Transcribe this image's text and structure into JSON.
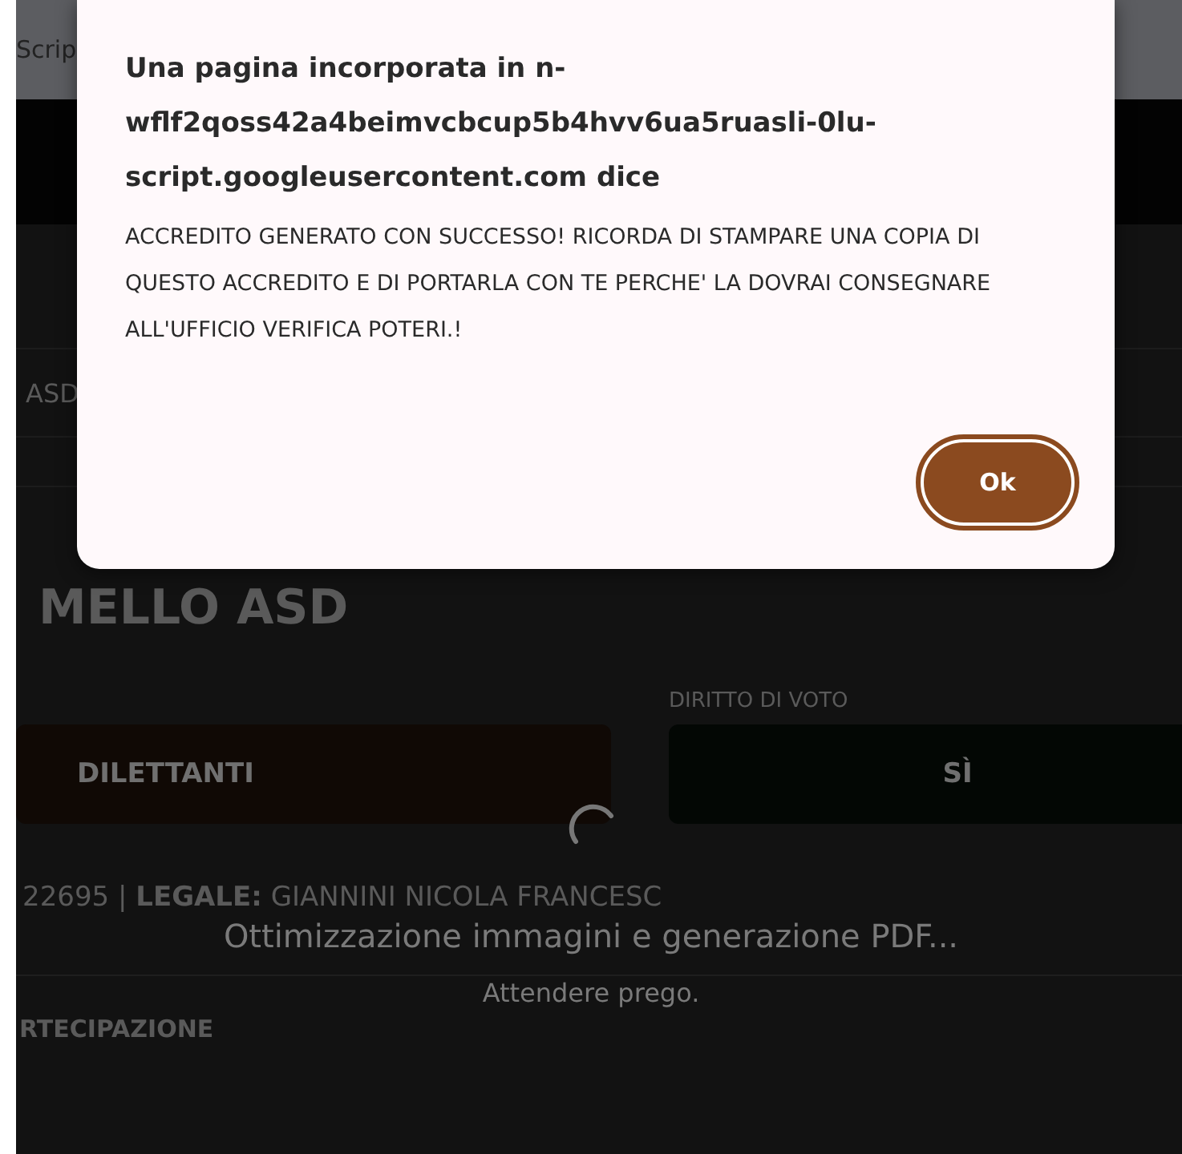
{
  "page": {
    "top_bar_text": "Scrip",
    "row_text": "ASD",
    "title": "MELLO ASD",
    "vote_label": "DIRITTO DI VOTO",
    "category_badge": "DILETTANTI",
    "vote_badge": "SÌ",
    "info_line": "22695 | **LEGALE:** GIANNINI NICOLA FRANCESC",
    "section_title": "RTECIPAZIONE"
  },
  "loading": {
    "message": "Ottimizzazione immagini e generazione PDF...",
    "sub_message": "Attendere prego."
  },
  "dialog": {
    "title": "Una pagina incorporata in n-wflf2qoss42a4beimvcbcup5b4hvv6ua5ruasli-0lu-script.googleusercontent.com dice",
    "message": "ACCREDITO GENERATO CON SUCCESSO! RICORDA DI STAMPARE UNA COPIA DI QUESTO ACCREDITO E DI PORTARLA CON TE PERCHE' LA DOVRAI CONSEGNARE ALL'UFFICIO VERIFICA POTERI.!",
    "button": "Ok"
  }
}
